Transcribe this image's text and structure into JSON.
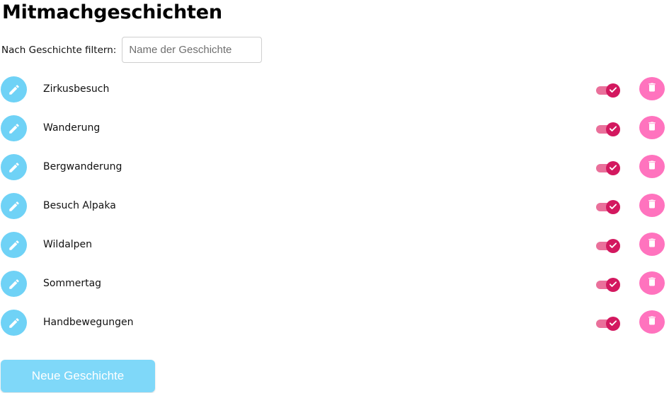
{
  "page": {
    "title": "Mitmachgeschichten"
  },
  "filter": {
    "label": "Nach Geschichte filtern:",
    "placeholder": "Name der Geschichte",
    "value": ""
  },
  "stories": [
    {
      "name": "Zirkusbesuch",
      "active": true
    },
    {
      "name": "Wanderung",
      "active": true
    },
    {
      "name": "Bergwanderung",
      "active": true
    },
    {
      "name": "Besuch Alpaka",
      "active": true
    },
    {
      "name": "Wildalpen",
      "active": true
    },
    {
      "name": "Sommertag",
      "active": true
    },
    {
      "name": "Handbewegungen",
      "active": true
    }
  ],
  "icons": {
    "edit": "pencil-icon",
    "delete": "trash-icon",
    "toggle_on": "check-icon"
  },
  "colors": {
    "edit_button": "#6fd2f6",
    "toggle_track": "#ea709b",
    "toggle_knob": "#d3185f",
    "delete_button": "#ff73be",
    "new_button": "#7fd8f9"
  },
  "actions": {
    "new_story_label": "Neue Geschichte"
  }
}
